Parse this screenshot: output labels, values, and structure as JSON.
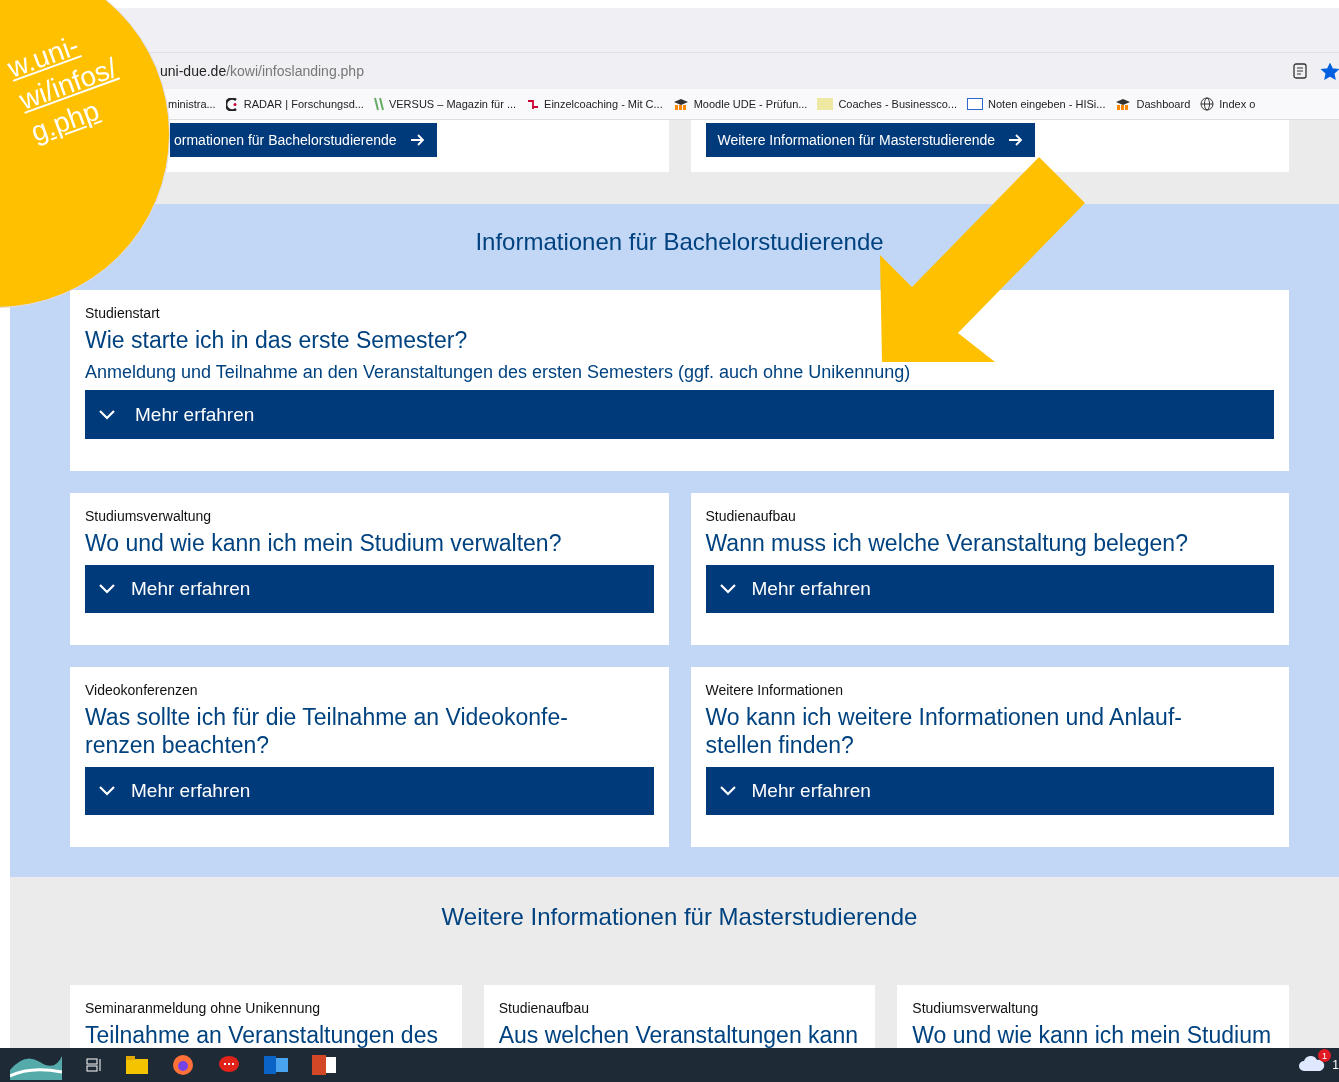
{
  "overlay": {
    "url_lines": [
      "w.uni-",
      "wi/infos/",
      "g.php"
    ]
  },
  "browser": {
    "address_host": "uni-due.de",
    "address_path": "/kowi/infoslanding.php",
    "bookmarked": true,
    "bookmarks": [
      {
        "label": "ministra..."
      },
      {
        "label": "RADAR | Forschungsd..."
      },
      {
        "label": "VERSUS – Magazin für ..."
      },
      {
        "label": "Einzelcoaching - Mit C..."
      },
      {
        "label": "Moodle UDE - Prüfun..."
      },
      {
        "label": "Coaches - Businessco..."
      },
      {
        "label": "Noten eingeben - HISi..."
      },
      {
        "label": "Dashboard"
      },
      {
        "label": "Index o"
      }
    ]
  },
  "top_cards": [
    {
      "button": "ormationen für Bachelorstudierende"
    },
    {
      "button": "Weitere Informationen für Masterstudierende"
    }
  ],
  "bachelor": {
    "heading": "Informationen für Bachelorstudierende",
    "featured": {
      "category": "Studienstart",
      "title": "Wie starte ich in das erste Semester?",
      "subtitle": "Anmeldung und Teilnahme an den Veranstaltungen des ersten Semesters (ggf. auch ohne Unikennung)",
      "button": "Mehr erfahren"
    },
    "cards": [
      {
        "category": "Studiumsverwaltung",
        "title": [
          "Wo und wie kann ich mein Studium verwalten?"
        ],
        "button": "Mehr erfahren"
      },
      {
        "category": "Studienaufbau",
        "title": [
          "Wann muss ich welche Veranstaltung belegen?"
        ],
        "button": "Mehr erfahren"
      },
      {
        "category": "Videokonferenzen",
        "title": [
          "Was sollte ich für die Teilnahme an Videokonfe-",
          "renzen beachten?"
        ],
        "button": "Mehr erfahren"
      },
      {
        "category": "Weitere Informationen",
        "title": [
          "Wo kann ich weitere Informationen und Anlauf-",
          "stellen finden?"
        ],
        "button": "Mehr erfahren"
      }
    ]
  },
  "master": {
    "heading": "Weitere Informationen für Masterstudierende",
    "cards": [
      {
        "category": "Seminaranmeldung ohne Unikennung",
        "title": "Teilnahme an Veranstaltungen des"
      },
      {
        "category": "Studienaufbau",
        "title": "Aus welchen Veranstaltungen kann"
      },
      {
        "category": "Studiumsverwaltung",
        "title": "Wo und wie kann ich mein Studium"
      }
    ]
  },
  "taskbar": {
    "notification_count": "1",
    "clock": "1"
  }
}
